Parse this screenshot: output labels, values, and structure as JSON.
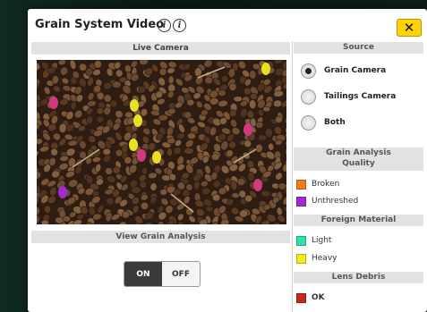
{
  "dialog": {
    "title": "Grain System Video",
    "close_symbol": "✕",
    "info_icons": [
      "info-icon",
      "info-icon"
    ]
  },
  "left_panel": {
    "header": "Live Camera",
    "footer": "View Grain Analysis",
    "toggle": {
      "on_label": "ON",
      "off_label": "OFF",
      "selected": "ON"
    }
  },
  "source": {
    "header": "Source",
    "options": [
      {
        "label": "Grain Camera",
        "selected": true
      },
      {
        "label": "Tailings Camera",
        "selected": false
      },
      {
        "label": "Both",
        "selected": false
      }
    ]
  },
  "grain_analysis": {
    "header_line1": "Grain Analysis",
    "header_line2": "Quality",
    "quality": [
      {
        "label": "Broken",
        "color": "#f07d1a"
      },
      {
        "label": "Unthreshed",
        "color": "#a22ad0"
      }
    ],
    "foreign_material_header": "Foreign Material",
    "foreign_material": [
      {
        "label": "Light",
        "color": "#2fe1ad"
      },
      {
        "label": "Heavy",
        "color": "#f5ea1c"
      }
    ],
    "lens_debris_header": "Lens Debris",
    "lens_debris": {
      "label": "OK",
      "color": "#c8281c"
    }
  },
  "colors": {
    "close_button": "#ffd400",
    "header_bg": "#e2e2e2"
  }
}
